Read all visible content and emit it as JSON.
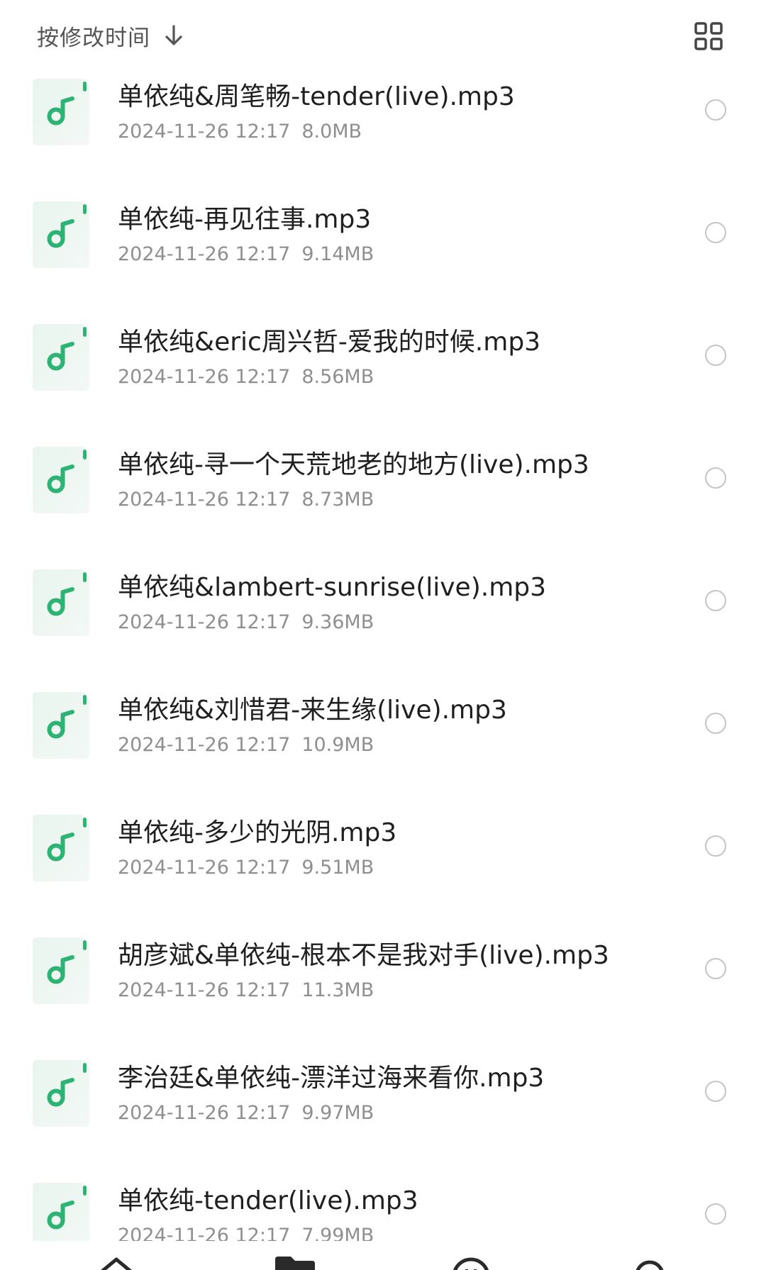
{
  "header": {
    "sort_label": "按修改时间",
    "sort_icon": "arrow-down-icon",
    "view_toggle_icon": "grid-view-icon"
  },
  "colors": {
    "accent": "#2db374",
    "icon_bg": "#edf7f1",
    "text_primary": "#1f1f1f",
    "text_secondary": "#8f8f8f"
  },
  "files": [
    {
      "name": "单依纯&周笔畅-tender(live).mp3",
      "date": "2024-11-26 12:17",
      "size": "8.0MB"
    },
    {
      "name": "单依纯-再见往事.mp3",
      "date": "2024-11-26 12:17",
      "size": "9.14MB"
    },
    {
      "name": "单依纯&eric周兴哲-爱我的时候.mp3",
      "date": "2024-11-26 12:17",
      "size": "8.56MB"
    },
    {
      "name": "单依纯-寻一个天荒地老的地方(live).mp3",
      "date": "2024-11-26 12:17",
      "size": "8.73MB"
    },
    {
      "name": "单依纯&lambert-sunrise(live).mp3",
      "date": "2024-11-26 12:17",
      "size": "9.36MB"
    },
    {
      "name": "单依纯&刘惜君-来生缘(live).mp3",
      "date": "2024-11-26 12:17",
      "size": "10.9MB"
    },
    {
      "name": "单依纯-多少的光阴.mp3",
      "date": "2024-11-26 12:17",
      "size": "9.51MB"
    },
    {
      "name": "胡彦斌&单依纯-根本不是我对手(live).mp3",
      "date": "2024-11-26 12:17",
      "size": "11.3MB"
    },
    {
      "name": "李治廷&单依纯-漂洋过海来看你.mp3",
      "date": "2024-11-26 12:17",
      "size": "9.97MB"
    },
    {
      "name": "单依纯-tender(live).mp3",
      "date": "2024-11-26 12:17",
      "size": "7.99MB"
    }
  ],
  "bottom_nav": {
    "icons": [
      "home-icon",
      "folder-icon",
      "play-circle-icon",
      "search-icon"
    ]
  }
}
